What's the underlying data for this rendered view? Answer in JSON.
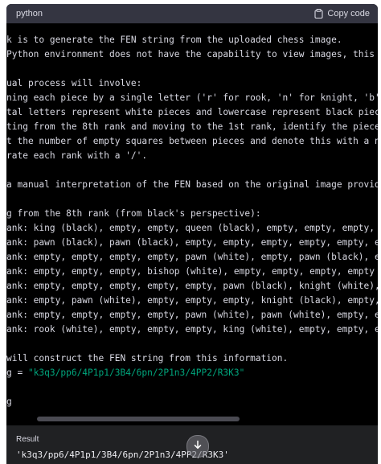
{
  "header": {
    "language": "python",
    "copy_label": "Copy code"
  },
  "code_lines": [
    "k is to generate the FEN string from the uploaded chess image.",
    "Python environment does not have the capability to view images, this will",
    "",
    "ual process will involve:",
    "ning each piece by a single letter ('r' for rook, 'n' for knight, 'b' for",
    "tal letters represent white pieces and lowercase represent black pieces.",
    "ting from the 8th rank and moving to the 1st rank, identify the pieces on",
    "t the number of empty squares between pieces and denote this with a numbe",
    "rate each rank with a '/'.",
    "",
    "a manual interpretation of the FEN based on the original image provided by",
    "",
    "g from the 8th rank (from black's perspective):",
    "ank: king (black), empty, empty, queen (black), empty, empty, empty, rook",
    "ank: pawn (black), pawn (black), empty, empty, empty, empty, empty, empty",
    "ank: empty, empty, empty, empty, pawn (white), empty, pawn (black), empty",
    "ank: empty, empty, empty, bishop (white), empty, empty, empty, empty",
    "ank: empty, empty, empty, empty, empty, pawn (black), knight (white), empt",
    "ank: empty, pawn (white), empty, empty, empty, knight (black), empty, empt",
    "ank: empty, empty, empty, empty, pawn (white), pawn (white), empty, empty",
    "ank: rook (white), empty, empty, empty, king (white), empty, empty, empty",
    "",
    "will construct the FEN string from this information.",
    "g = \"k3q3/pp6/4P1p1/3B4/6pn/2P1n3/4PP2/R3K3\"",
    "",
    "g"
  ],
  "fen_assign_prefix": "g = ",
  "fen_assign_string": "\"k3q3/pp6/4P1p1/3B4/6pn/2P1n3/4PP2/R3K3\"",
  "result": {
    "label": "Result",
    "value": "'k3q3/pp6/4P1p1/3B4/6pn/2P1n3/4PP2/R3K3'"
  },
  "icons": {
    "copy": "clipboard-icon",
    "scroll_down": "arrow-down-icon"
  },
  "colors": {
    "string_literal": "#00a67d",
    "code_text": "#d9d9e3",
    "panel_bg": "#000000",
    "header_bg": "#343541",
    "result_bg": "#202123"
  }
}
